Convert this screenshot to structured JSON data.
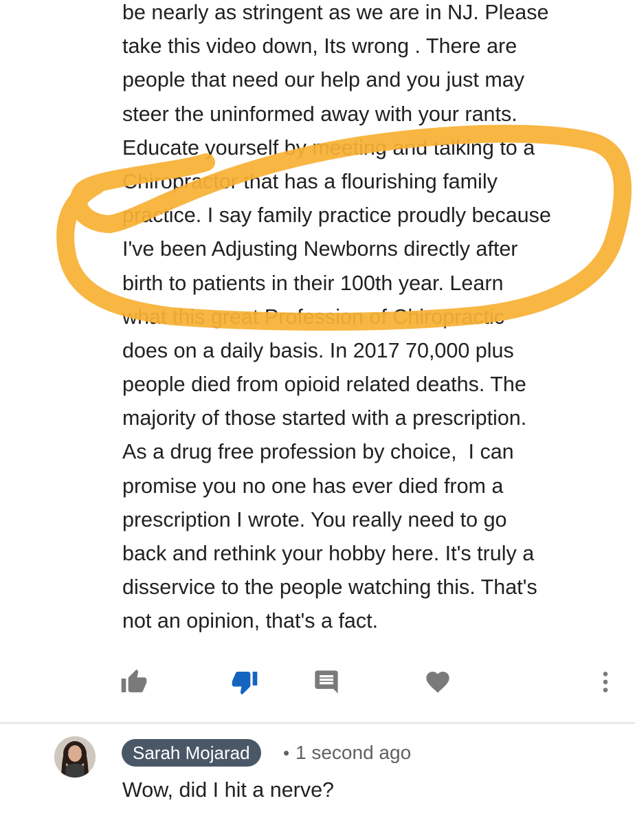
{
  "comment": {
    "lines": [
      "be nearly as stringent as we are in NJ. Please",
      "take this video down, Its wrong . There are",
      "people that need our help and you just may",
      "steer the uninformed away with your rants.",
      "Educate yourself by meeting and talking to a",
      "Chiropractor that has a flourishing family",
      "practice. I say family practice proudly because",
      "I've been Adjusting Newborns directly after",
      "birth to patients in their 100th year. Learn",
      "what this great Profession of Chiropractic",
      "does on a daily basis. In 2017 70,000 plus",
      "people died from opioid related deaths. The",
      "majority of those started with a prescription.",
      "As a drug free profession by choice,  I can",
      "promise you no one has ever died from a",
      "prescription I wrote. You really need to go",
      "back and rethink your hobby here. It's truly a",
      "disservice to the people watching this. That's",
      "not an opinion, that's a fact."
    ],
    "actions": [
      {
        "icon": "thumbs-up-icon",
        "state": "inactive"
      },
      {
        "icon": "thumbs-down-icon",
        "state": "active"
      },
      {
        "icon": "reply-icon",
        "state": "inactive"
      },
      {
        "icon": "heart-icon",
        "state": "inactive"
      },
      {
        "icon": "more-vert-icon",
        "state": "inactive"
      }
    ]
  },
  "reply": {
    "author": "Sarah Mojarad",
    "separator": "•",
    "timestamp": "1 second ago",
    "text": "Wow, did I hit a nerve?"
  },
  "colors": {
    "text": "#212121",
    "highlight_marker": "#f7b035",
    "active_blue": "#1565c0",
    "icon_gray": "#7a7a7a",
    "author_chip": "#4a5766",
    "timestamp": "#606060"
  }
}
